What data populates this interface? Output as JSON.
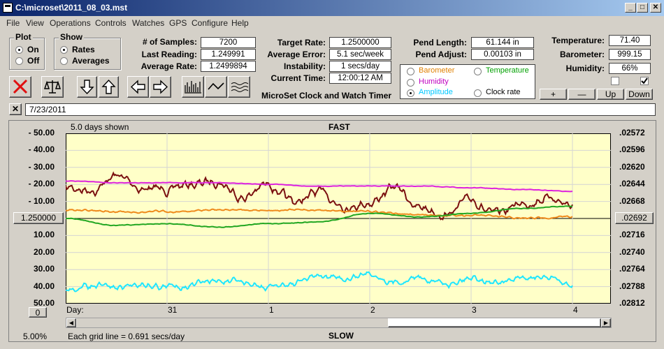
{
  "window": {
    "title": "C:\\microset\\2011_08_03.mst"
  },
  "menu": [
    "File",
    "View",
    "Operations",
    "Controls",
    "Watches",
    "GPS",
    "Configure",
    "Help"
  ],
  "plot": {
    "label": "Plot",
    "on": "On",
    "off": "Off",
    "selected": "On"
  },
  "show": {
    "label": "Show",
    "rates": "Rates",
    "averages": "Averages",
    "selected": "Rates"
  },
  "stats": {
    "samples_label": "# of Samples:",
    "samples": "7200",
    "last_label": "Last Reading:",
    "last": "1.249991",
    "avg_rate_label": "Average Rate:",
    "avg_rate": "1.2499894"
  },
  "target": {
    "rate_label": "Target Rate:",
    "rate": "1.2500000",
    "error_label": "Average Error:",
    "error": "5.1 sec/week",
    "instab_label": "Instability:",
    "instab": "1 secs/day",
    "time_label": "Current Time:",
    "time": "12:00:12 AM"
  },
  "product_label": "MicroSet Clock and Watch Timer",
  "pend": {
    "length_label": "Pend Length:",
    "length": "61.144 in",
    "adjust_label": "Pend Adjust:",
    "adjust": "0.00103 in"
  },
  "series_select": {
    "items": [
      {
        "label": "Barometer",
        "color": "#e08000",
        "selected": false
      },
      {
        "label": "Temperature",
        "color": "#00a000",
        "selected": false
      },
      {
        "label": "Humidity",
        "color": "#c000c0",
        "selected": false
      },
      {
        "label": "Amplitude",
        "color": "#00c8ff",
        "selected": true
      },
      {
        "label": "Clock rate",
        "color": "#000000",
        "selected": false
      }
    ]
  },
  "env": {
    "temp_label": "Temperature:",
    "temp": "71.40",
    "baro_label": "Barometer:",
    "baro": "999.15",
    "hum_label": "Humidity:",
    "hum": "66%"
  },
  "scale_buttons": {
    "plus": "+",
    "minus": "—",
    "up": "Up",
    "down": "Down"
  },
  "note": {
    "close": "✕",
    "text": "7/23/2011"
  },
  "chart": {
    "days_shown": "5.0 days shown",
    "top_label": "FAST",
    "bottom_label": "SLOW",
    "left_ticks": [
      "-  50.00",
      "-  40.00",
      "-  30.00",
      "-  20.00",
      "-  10.00",
      "",
      "10.00",
      "20.00",
      "30.00",
      "40.00",
      "50.00"
    ],
    "center_value": "1.250000",
    "right_ticks": [
      ".02572",
      ".02596",
      ".02620",
      ".02644",
      ".02668",
      "",
      ".02716",
      ".02740",
      ".02764",
      ".02788",
      ".02812"
    ],
    "right_center": ".02692",
    "x_axis_label": "Day:",
    "x_ticks": [
      "31",
      "1",
      "2",
      "3",
      "4"
    ],
    "scroll_value": "0",
    "zoom": "5.00%",
    "grid_note": "Each grid line = 0.691 secs/day",
    "colors": {
      "background": "#ffffc8",
      "grid": "#d4d4d4",
      "clock_rate": "#7a0f0f",
      "humidity": "#dd22dd",
      "barometer": "#ee8a1c",
      "temperature": "#21a621",
      "amplitude": "#1ee6ff"
    }
  },
  "chart_data": {
    "type": "line",
    "xlabel": "Day",
    "ylabel": "",
    "x_range": [
      0,
      5
    ],
    "ylim": [
      -50,
      50
    ],
    "series": [
      {
        "name": "Clock rate",
        "x": [
          0,
          0.25,
          0.5,
          0.75,
          1,
          1.25,
          1.5,
          1.75,
          2,
          2.25,
          2.5,
          2.75,
          3,
          3.25,
          3.5,
          3.75,
          4,
          4.25,
          4.5,
          4.75,
          5
        ],
        "values": [
          -18,
          -17,
          -25,
          -18,
          -17,
          -20,
          -22,
          -13,
          -20,
          -9,
          -15,
          -8,
          -10,
          -18,
          -6,
          -3,
          -11,
          -2,
          -9,
          -13,
          -8
        ]
      },
      {
        "name": "Humidity",
        "x": [
          0,
          0.5,
          1,
          1.5,
          2,
          2.5,
          3,
          3.5,
          4,
          4.5,
          5
        ],
        "values": [
          -22,
          -21,
          -21,
          -21,
          -20,
          -19,
          -19,
          -19,
          -18,
          -17,
          -16
        ]
      },
      {
        "name": "Barometer",
        "x": [
          0,
          0.5,
          1,
          1.5,
          2,
          2.5,
          3,
          3.5,
          4,
          4.5,
          5
        ],
        "values": [
          -5,
          -4,
          -4,
          -5,
          -5,
          -5,
          -4,
          -2,
          -2,
          0,
          -1
        ]
      },
      {
        "name": "Temperature",
        "x": [
          0,
          0.5,
          1,
          1.5,
          2,
          2.5,
          3,
          3.5,
          4,
          4.5,
          5
        ],
        "values": [
          0,
          4,
          3,
          5,
          3,
          2,
          -3,
          -1,
          -3,
          -6,
          -7
        ]
      },
      {
        "name": "Amplitude",
        "x": [
          0,
          0.25,
          0.5,
          0.75,
          1,
          1.25,
          1.5,
          1.75,
          2,
          2.25,
          2.5,
          2.75,
          3,
          3.25,
          3.5,
          3.75,
          4,
          4.25,
          4.5,
          4.75,
          5
        ],
        "values": [
          42,
          40,
          41,
          38,
          40,
          39,
          37,
          38,
          41,
          38,
          34,
          36,
          32,
          37,
          34,
          38,
          34,
          37,
          36,
          35,
          39
        ]
      }
    ]
  }
}
